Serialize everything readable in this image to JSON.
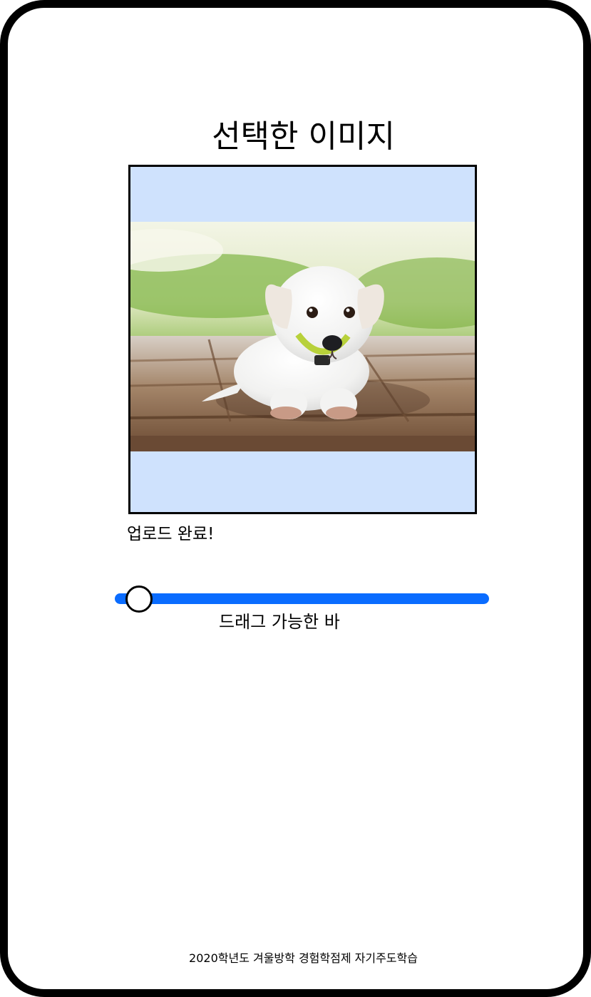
{
  "page": {
    "title": "선택한 이미지"
  },
  "image_preview": {
    "alt": "puppy-photo",
    "background_color": "#cfe2fd"
  },
  "upload": {
    "status_text": "업로드 완료!"
  },
  "slider": {
    "caption": "드래그 가능한 바",
    "value_fraction": 0.04,
    "track_color": "#0a6cff"
  },
  "footer": {
    "text": "2020학년도 겨울방학 경험학점제 자기주도학습"
  }
}
